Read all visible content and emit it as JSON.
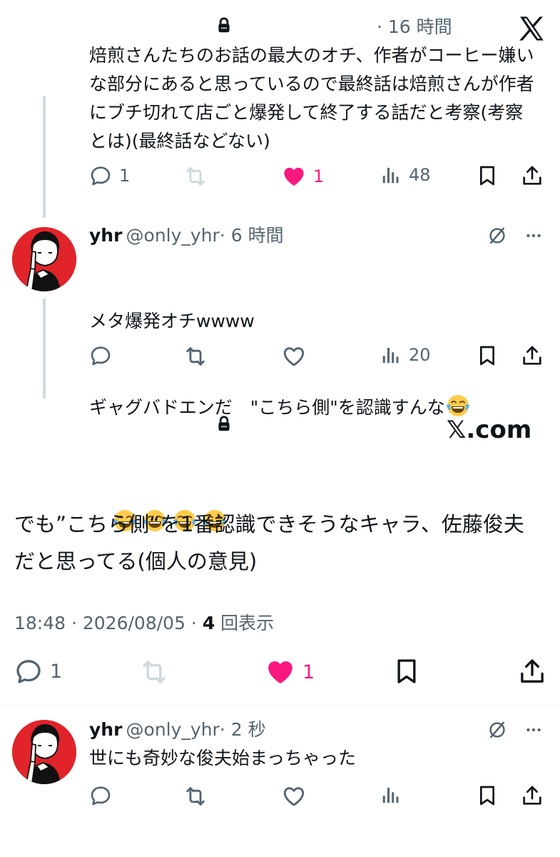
{
  "post1": {
    "time": "· 16 時間",
    "text": "焙煎さんたちのお話の最大のオチ、作者がコーヒー嫌いな部分にあると思っているので最終話は焙煎さんが作者にブチ切れて店ごと爆発して終了する話だと考察(考察とは)(最終話などない)",
    "replies": "1",
    "likes": "1",
    "views": "48",
    "like_color": "#f91880"
  },
  "post2": {
    "name": "yhr",
    "handle": "@only_yhr",
    "time": "· 6 時間",
    "line1": "メタ爆発オチwwww",
    "line2": "ギャグバドエンだ　\"こちら側\"を認識すんな",
    "views": "20"
  },
  "banner": {
    "brand": "𝕏.com"
  },
  "main": {
    "text": "でも”こちら側“を1番認識できそうなキャラ、佐藤俊夫だと思ってる(個人の意見)",
    "time": "18:48 · 2026/08/05 · ",
    "views_count": "4",
    "views_label": " 回表示",
    "replies": "1",
    "likes": "1"
  },
  "post3": {
    "name": "yhr",
    "handle": "@only_yhr",
    "time": "· 2 秒",
    "text": "世にも奇妙な俊夫始まっちゃった"
  },
  "icons": {
    "x_logo": "x-logo-icon",
    "lock": "lock-icon",
    "reply": "reply-icon",
    "retweet": "retweet-icon",
    "like": "heart-icon",
    "views": "views-icon",
    "bookmark": "bookmark-icon",
    "share": "share-icon",
    "grok": "grok-icon",
    "more": "more-icon",
    "emoji": "laughing-tears-emoji"
  }
}
